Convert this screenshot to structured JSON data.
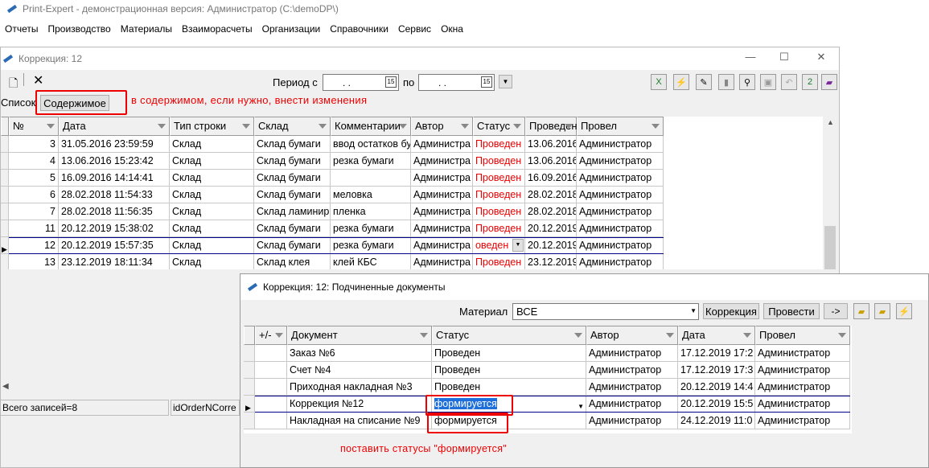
{
  "app": {
    "title": "Print-Expert - демонстрационная версия: Администратор (C:\\demoDP\\)"
  },
  "menu": [
    "Отчеты",
    "Производство",
    "Материалы",
    "Взаиморасчеты",
    "Организации",
    "Справочники",
    "Сервис",
    "Окна"
  ],
  "window": {
    "title": "Коррекция: 12",
    "period_label": "Период с",
    "period_from": ". .",
    "to_label": "по",
    "period_to": ". .",
    "list_label": "Список",
    "contents_button": "Содержимое",
    "note": "в содержимом, если нужно, внести изменения",
    "columns": [
      "№",
      "Дата",
      "Тип строки",
      "Склад",
      "Комментарии",
      "Автор",
      "Статус",
      "Проведен",
      "Провел"
    ],
    "rows": [
      {
        "no": "3",
        "date": "31.05.2016 23:59:59",
        "type": "Склад",
        "stock": "Склад бумаги",
        "comment": "ввод остатков бу",
        "author": "Администра",
        "status": "Проведен",
        "posted": "13.06.2016",
        "poster": "Администратор"
      },
      {
        "no": "4",
        "date": "13.06.2016 15:23:42",
        "type": "Склад",
        "stock": "Склад бумаги",
        "comment": "резка бумаги",
        "author": "Администра",
        "status": "Проведен",
        "posted": "13.06.2016",
        "poster": "Администратор"
      },
      {
        "no": "5",
        "date": "16.09.2016 14:14:41",
        "type": "Склад",
        "stock": "Склад бумаги",
        "comment": "",
        "author": "Администра",
        "status": "Проведен",
        "posted": "16.09.2016",
        "poster": "Администратор"
      },
      {
        "no": "6",
        "date": "28.02.2018 11:54:33",
        "type": "Склад",
        "stock": "Склад бумаги",
        "comment": "меловка",
        "author": "Администра",
        "status": "Проведен",
        "posted": "28.02.2018",
        "poster": "Администратор"
      },
      {
        "no": "7",
        "date": "28.02.2018 11:56:35",
        "type": "Склад",
        "stock": "Склад ламинир",
        "comment": "пленка",
        "author": "Администра",
        "status": "Проведен",
        "posted": "28.02.2018",
        "poster": "Администратор"
      },
      {
        "no": "11",
        "date": "20.12.2019 15:38:02",
        "type": "Склад",
        "stock": "Склад бумаги",
        "comment": "резка бумаги",
        "author": "Администра",
        "status": "Проведен",
        "posted": "20.12.2019",
        "poster": "Администратор"
      },
      {
        "no": "12",
        "date": "20.12.2019 15:57:35",
        "type": "Склад",
        "stock": "Склад бумаги",
        "comment": "резка бумаги",
        "author": "Администра",
        "status": "оведен",
        "posted": "20.12.2019",
        "poster": "Администратор"
      },
      {
        "no": "13",
        "date": "23.12.2019 18:11:34",
        "type": "Склад",
        "stock": "Склад клея",
        "comment": "клей КБС",
        "author": "Администра",
        "status": "Проведен",
        "posted": "23.12.2019",
        "poster": "Администратор"
      }
    ],
    "total": "Всего записей=8",
    "status_field": "idOrderNCorre"
  },
  "subwindow": {
    "title": "Коррекция: 12: Подчиненные документы",
    "material_label": "Материал",
    "material_value": "ВСЕ",
    "buttons": [
      "Коррекция",
      "Провести",
      "->"
    ],
    "columns": [
      "+/-",
      "Документ",
      "Статус",
      "Автор",
      "Дата",
      "Провел"
    ],
    "rows": [
      {
        "doc": "Заказ №6",
        "status": "Проведен",
        "author": "Администратор",
        "date": "17.12.2019 17:2",
        "poster": "Администратор"
      },
      {
        "doc": "Счет №4",
        "status": "Проведен",
        "author": "Администратор",
        "date": "17.12.2019 17:3",
        "poster": "Администратор"
      },
      {
        "doc": "Приходная накладная №3",
        "status": "Проведен",
        "author": "Администратор",
        "date": "20.12.2019 14:4",
        "poster": "Администратор"
      },
      {
        "doc": "Коррекция №12",
        "status": "формируется",
        "author": "Администратор",
        "date": "20.12.2019 15:5",
        "poster": "Администратор"
      },
      {
        "doc": "Накладная на списание №9",
        "status": "формируется",
        "author": "Администратор",
        "date": "24.12.2019 11:0",
        "poster": "Администратор"
      }
    ],
    "note": "поставить статусы \"формируется\""
  },
  "colors": {
    "highlight_red": "#e00000",
    "selection_blue": "#1e6fd9"
  }
}
